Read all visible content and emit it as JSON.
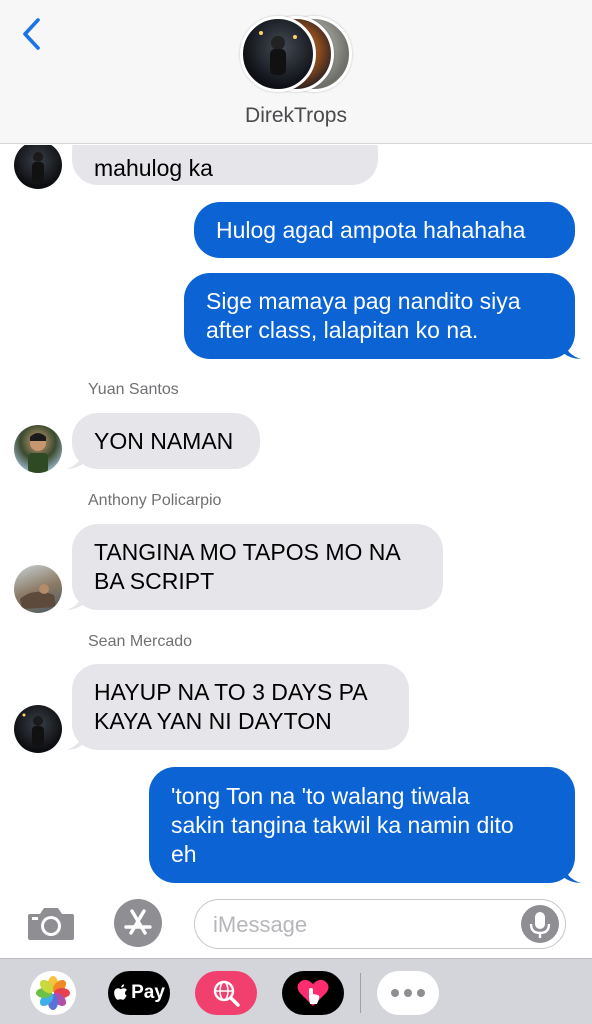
{
  "header": {
    "group_name": "DirekTrops",
    "back_icon": "chevron-left-icon"
  },
  "messages": [
    {
      "direction": "incoming",
      "text": "mahulog ka",
      "sender": ""
    },
    {
      "direction": "outgoing",
      "text": "Hulog agad ampota hahahaha"
    },
    {
      "direction": "outgoing",
      "lines": [
        "Sige mamaya pag nandito siya",
        "after class, lalapitan ko na."
      ]
    },
    {
      "direction": "incoming",
      "sender": "Yuan Santos",
      "text": "YON NAMAN"
    },
    {
      "direction": "incoming",
      "sender": "Anthony Policarpio",
      "lines": [
        "TANGINA MO TAPOS MO NA",
        "BA SCRIPT"
      ]
    },
    {
      "direction": "incoming",
      "sender": "Sean Mercado",
      "lines": [
        "HAYUP NA TO 3 DAYS PA",
        "KAYA YAN NI DAYTON"
      ]
    },
    {
      "direction": "outgoing",
      "lines": [
        "'tong Ton na 'to walang tiwala",
        "sakin tangina takwil ka namin dito",
        "eh"
      ]
    }
  ],
  "input": {
    "placeholder": "iMessage",
    "camera_icon": "camera-icon",
    "app_store_icon": "app-store-icon",
    "mic_icon": "microphone-icon"
  },
  "drawer": {
    "apps": [
      {
        "name": "photos",
        "icon": "photos-icon"
      },
      {
        "name": "apple-pay",
        "label": "Pay",
        "icon": "apple-icon"
      },
      {
        "name": "web-search",
        "icon": "globe-search-icon"
      },
      {
        "name": "digital-touch",
        "icon": "heart-touch-icon"
      },
      {
        "name": "more",
        "icon": "more-dots-icon"
      }
    ]
  },
  "colors": {
    "outgoing_bubble": "#0b63d4",
    "incoming_bubble": "#e5e5ea",
    "tint": "#1a73e8",
    "header_bg": "#f7f7f8",
    "drawer_bg": "#d4d5da"
  }
}
